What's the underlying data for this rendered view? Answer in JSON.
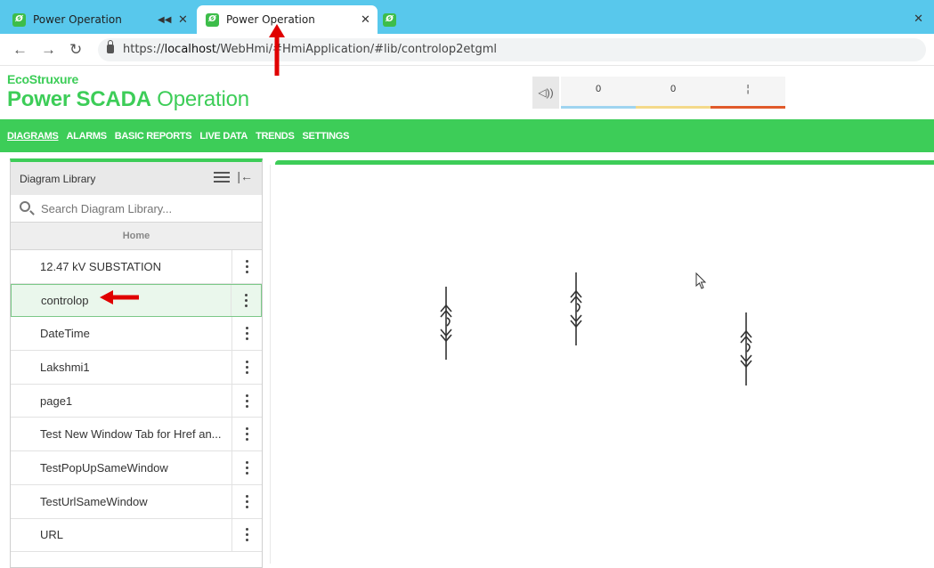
{
  "browser": {
    "tabs": [
      {
        "title": "Power Operation",
        "muted": true
      },
      {
        "title": "Power Operation",
        "active": true
      },
      {
        "title": ""
      }
    ],
    "url_prefix": "https://",
    "url_host": "localhost",
    "url_path": "/WebHmi/#HmiApplication/#lib/controlop2etgml"
  },
  "header": {
    "brand_top": "EcoStruxure",
    "product_bold": "Power SCADA",
    "product_rest": " Operation"
  },
  "alarms": {
    "counters": [
      {
        "value": "0",
        "color": "#9fd4f0"
      },
      {
        "value": "0",
        "color": "#f4d98a"
      },
      {
        "value": "¦",
        "color": "#e05a2a"
      }
    ]
  },
  "nav": {
    "items": [
      "DIAGRAMS",
      "ALARMS",
      "BASIC REPORTS",
      "LIVE DATA",
      "TRENDS",
      "SETTINGS"
    ]
  },
  "library": {
    "title": "Diagram Library",
    "search_placeholder": "Search Diagram Library...",
    "home_label": "Home",
    "items": [
      "12.47 kV SUBSTATION",
      "controlop",
      "DateTime",
      "Lakshmi1",
      "page1",
      "Test New Window Tab for Href an...",
      "TestPopUpSameWindow",
      "TestUrlSameWindow",
      "URL"
    ],
    "selected_index": 1
  },
  "colors": {
    "brand_green": "#3dcd58",
    "tab_bar": "#58c8ec",
    "annotation_red": "#e00000"
  }
}
